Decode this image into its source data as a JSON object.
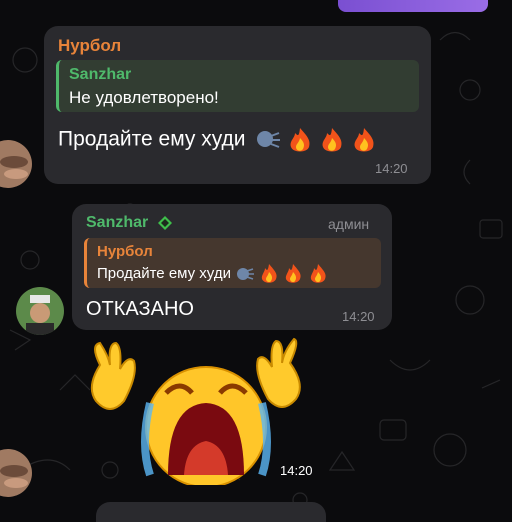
{
  "message1": {
    "sender": "Нурбол",
    "reply": {
      "name": "Sanzhar",
      "text": "Не удовлетворено!"
    },
    "text": "Продайте ему худи",
    "time": "14:20"
  },
  "message2": {
    "sender": "Sanzhar",
    "badge": "админ",
    "reply": {
      "name": "Нурбол",
      "text": "Продайте ему худи"
    },
    "text": "ОТКАЗАНО",
    "time": "14:20"
  },
  "sticker": {
    "time": "14:20"
  },
  "colors": {
    "bubble": "#2a2a2e",
    "sender_nurbol": "#e8843a",
    "sender_sanzhar": "#4fb96b",
    "time": "#8e8e93",
    "accent": "#8a5ce0"
  },
  "icons": [
    "speaking-head-icon",
    "fire-icon",
    "green-diamond-icon",
    "crying-face-icon",
    "raised-hand-icon"
  ]
}
